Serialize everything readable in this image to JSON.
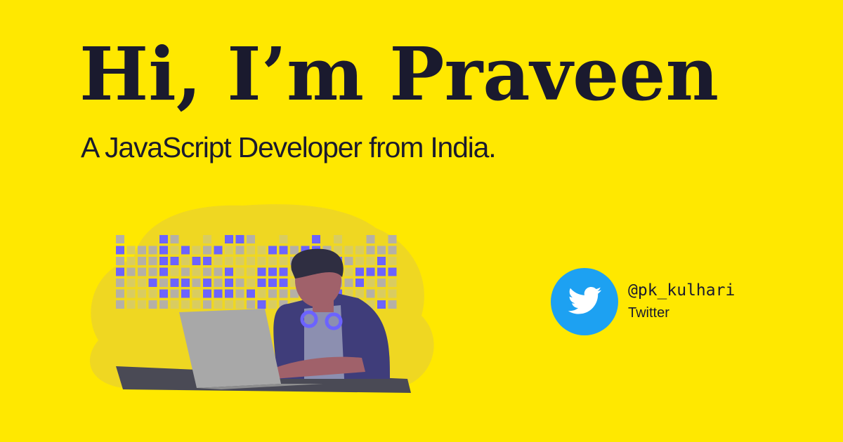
{
  "hero": {
    "title": "Hi, I’m Praveen",
    "subtitle": "A JavaScript Developer from India."
  },
  "social": {
    "handle": "@pk_kulhari",
    "platform": "Twitter",
    "icon": "twitter-bird-icon"
  },
  "colors": {
    "background": "#FFE800",
    "text": "#1A1A2E",
    "twitter_blue": "#1DA1F2",
    "accent_purple": "#6C63FF",
    "jacket": "#3F3D7A",
    "laptop": "#A8A8A8",
    "desk": "#4A4A55",
    "skin": "#A0616A",
    "hair": "#2F2E41"
  }
}
